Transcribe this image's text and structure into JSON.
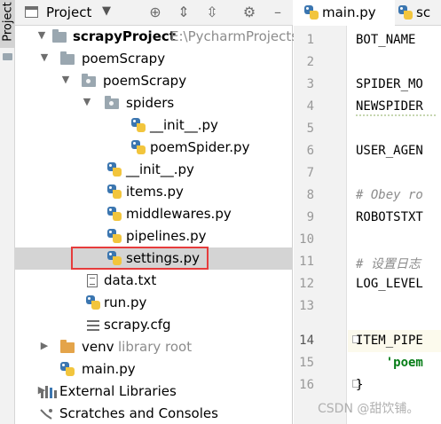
{
  "toolstrip": {
    "project_tab": "Project"
  },
  "panel": {
    "title": "Project"
  },
  "tree": [
    {
      "label": "scrapyProject",
      "hint": "E:\\PycharmProjects\\s",
      "bold": true
    },
    {
      "label": "poemScrapy"
    },
    {
      "label": "poemScrapy"
    },
    {
      "label": "spiders"
    },
    {
      "label": "__init__.py"
    },
    {
      "label": "poemSpider.py"
    },
    {
      "label": "__init__.py"
    },
    {
      "label": "items.py"
    },
    {
      "label": "middlewares.py"
    },
    {
      "label": "pipelines.py"
    },
    {
      "label": "settings.py"
    },
    {
      "label": "data.txt"
    },
    {
      "label": "run.py"
    },
    {
      "label": "scrapy.cfg"
    },
    {
      "label": "venv",
      "hint": "library root"
    },
    {
      "label": "main.py"
    },
    {
      "label": "External Libraries"
    },
    {
      "label": "Scratches and Consoles"
    }
  ],
  "tabs": [
    {
      "label": "main.py"
    },
    {
      "label": "sc"
    }
  ],
  "gutter": [
    "1",
    "2",
    "3",
    "4",
    "5",
    "6",
    "7",
    "8",
    "9",
    "10",
    "11",
    "12",
    "13",
    "14",
    "15",
    "16"
  ],
  "code": {
    "l1": "BOT_NAME",
    "l3": "SPIDER_MO",
    "l4": "NEWSPIDER",
    "l6": "USER_AGEN",
    "l8": "# Obey ro",
    "l9": "ROBOTSTXT",
    "l11": "# 设置日志",
    "l12": "LOG_LEVEL",
    "l14": "ITEM_PIPE",
    "l15": "    'poem",
    "l16": "}"
  },
  "watermark": "CSDN @甜饮铺。"
}
